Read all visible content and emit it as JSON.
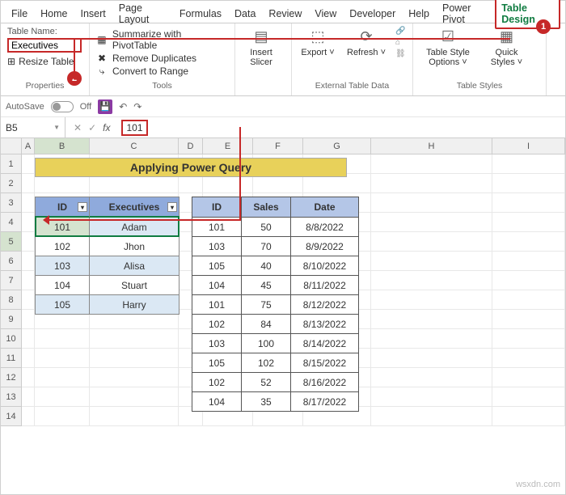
{
  "tabs": [
    "File",
    "Home",
    "Insert",
    "Page Layout",
    "Formulas",
    "Data",
    "Review",
    "View",
    "Developer",
    "Help",
    "Power Pivot",
    "Table Design"
  ],
  "ribbon": {
    "table_name_label": "Table Name:",
    "table_name_value": "Executives",
    "resize_table": "Resize Table",
    "group_properties": "Properties",
    "summarize": "Summarize with PivotTable",
    "remove_dupes": "Remove Duplicates",
    "convert_range": "Convert to Range",
    "group_tools": "Tools",
    "insert_slicer": "Insert Slicer",
    "export": "Export",
    "refresh": "Refresh",
    "group_external": "External Table Data",
    "table_style_options": "Table Style Options",
    "quick_styles": "Quick Styles",
    "group_styles": "Table Styles"
  },
  "autosave": {
    "label": "AutoSave",
    "state": "Off"
  },
  "namebox": "B5",
  "formula_value": "101",
  "columns": [
    "A",
    "B",
    "C",
    "D",
    "E",
    "F",
    "G",
    "H",
    "I"
  ],
  "title_banner": "Applying Power Query",
  "table1": {
    "headers": [
      "ID",
      "Executives"
    ],
    "rows": [
      {
        "id": "101",
        "name": "Adam"
      },
      {
        "id": "102",
        "name": "Jhon"
      },
      {
        "id": "103",
        "name": "Alisa"
      },
      {
        "id": "104",
        "name": "Stuart"
      },
      {
        "id": "105",
        "name": "Harry"
      }
    ]
  },
  "table2": {
    "headers": [
      "ID",
      "Sales",
      "Date"
    ],
    "rows": [
      {
        "id": "101",
        "sales": "50",
        "date": "8/8/2022"
      },
      {
        "id": "103",
        "sales": "70",
        "date": "8/9/2022"
      },
      {
        "id": "105",
        "sales": "40",
        "date": "8/10/2022"
      },
      {
        "id": "104",
        "sales": "45",
        "date": "8/11/2022"
      },
      {
        "id": "101",
        "sales": "75",
        "date": "8/12/2022"
      },
      {
        "id": "102",
        "sales": "84",
        "date": "8/13/2022"
      },
      {
        "id": "103",
        "sales": "100",
        "date": "8/14/2022"
      },
      {
        "id": "105",
        "sales": "102",
        "date": "8/15/2022"
      },
      {
        "id": "102",
        "sales": "52",
        "date": "8/16/2022"
      },
      {
        "id": "104",
        "sales": "35",
        "date": "8/17/2022"
      }
    ]
  },
  "badges": {
    "one": "1",
    "two": "2"
  },
  "watermark": "wsxdn.com"
}
